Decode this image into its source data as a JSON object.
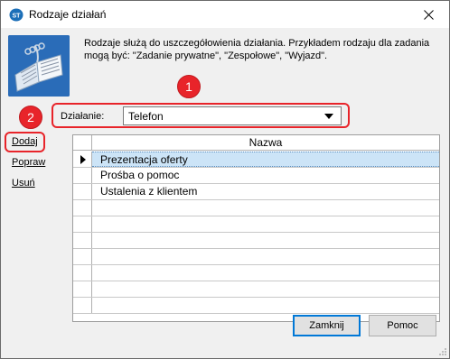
{
  "window": {
    "title": "Rodzaje działań",
    "icon": "app-logo-icon",
    "close_glyph": "✕"
  },
  "intro": {
    "text": "Rodzaje służą do uszczegółowienia działania. Przykładem rodzaju dla zadania mogą być: \"Zadanie prywatne\", \"Zespołowe\", \"Wyjazd\"."
  },
  "callouts": {
    "one": "1",
    "two": "2"
  },
  "filter": {
    "label": "Działanie:",
    "value": "Telefon"
  },
  "actions": {
    "add": "Dodaj",
    "edit": "Popraw",
    "delete": "Usuń"
  },
  "grid": {
    "column_header": "Nazwa",
    "rows": [
      "Prezentacja oferty",
      "Prośba o pomoc",
      "Ustalenia z klientem",
      "",
      "",
      "",
      "",
      "",
      "",
      ""
    ],
    "selected_index": 0
  },
  "buttons": {
    "close": "Zamknij",
    "help": "Pomoc"
  },
  "colors": {
    "callout": "#e8242a",
    "selection": "#cce4f7",
    "icon_blue": "#1f5fa8"
  }
}
